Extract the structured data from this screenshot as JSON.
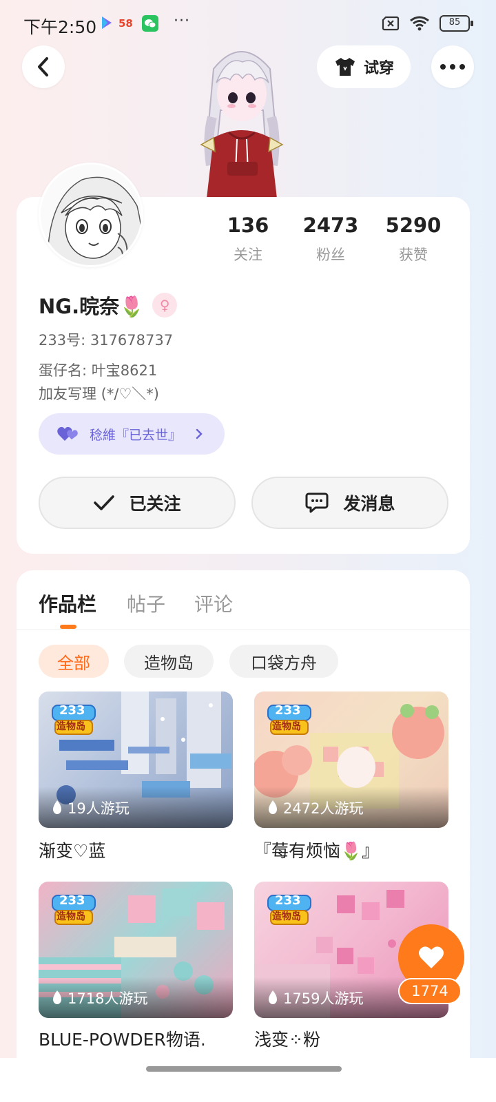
{
  "status_bar": {
    "time": "下午2:50",
    "app_badge_58": "58",
    "overflow": "···",
    "battery": "85"
  },
  "header": {
    "try_on_label": "试穿"
  },
  "profile": {
    "stats": [
      {
        "value": "136",
        "label": "关注"
      },
      {
        "value": "2473",
        "label": "粉丝"
      },
      {
        "value": "5290",
        "label": "获赞"
      }
    ],
    "name": "NG.晥奈🌷",
    "gender_symbol": "♀",
    "id_line": "233号: 317678737",
    "nickname_line": "蛋仔名: 叶宝8621",
    "bio": "加友写理 (*/♡＼*)",
    "cp_label": "稔維『已去世』",
    "follow_label": "已关注",
    "message_label": "发消息"
  },
  "tabs": [
    "作品栏",
    "帖子",
    "评论"
  ],
  "filters": [
    "全部",
    "造物岛",
    "口袋方舟"
  ],
  "works": [
    {
      "title": "渐变♡蓝",
      "plays": "19人游玩",
      "badge_top": "233",
      "badge_bottom": "造物岛"
    },
    {
      "title": "『莓有烦恼🌷』",
      "plays": "2472人游玩",
      "badge_top": "233",
      "badge_bottom": "造物岛"
    },
    {
      "title": "BLUE-POWDER物语.",
      "plays": "1718人游玩",
      "badge_top": "233",
      "badge_bottom": "造物岛"
    },
    {
      "title": "浅变⁘粉",
      "plays": "1759人游玩",
      "badge_top": "233",
      "badge_bottom": "造物岛"
    }
  ],
  "like": {
    "count": "1774"
  },
  "colors": {
    "accent": "#ff7a1a",
    "cp_pill_bg": "#e9e7fc",
    "cp_text": "#6a63d8"
  }
}
